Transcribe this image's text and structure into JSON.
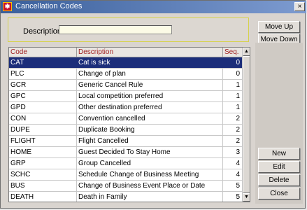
{
  "window": {
    "title": "Cancellation Codes",
    "close_glyph": "×"
  },
  "search": {
    "description_label": "Description",
    "description_value": ""
  },
  "table": {
    "headers": {
      "code": "Code",
      "description": "Description",
      "seq": "Seq."
    },
    "rows": [
      {
        "code": "CAT",
        "description": "Cat is sick",
        "seq": "0",
        "selected": true
      },
      {
        "code": "PLC",
        "description": "Change of plan",
        "seq": "0"
      },
      {
        "code": "GCR",
        "description": "Generic Cancel Rule",
        "seq": "1"
      },
      {
        "code": "GPC",
        "description": "Local competition preferred",
        "seq": "1"
      },
      {
        "code": "GPD",
        "description": "Other destination preferred",
        "seq": "1"
      },
      {
        "code": "CON",
        "description": "Convention cancelled",
        "seq": "2"
      },
      {
        "code": "DUPE",
        "description": "Duplicate Booking",
        "seq": "2"
      },
      {
        "code": "FLIGHT",
        "description": "Flight Cancelled",
        "seq": "2"
      },
      {
        "code": "HOME",
        "description": "Guest Decided To Stay Home",
        "seq": "3"
      },
      {
        "code": "GRP",
        "description": "Group Cancelled",
        "seq": "4"
      },
      {
        "code": "SCHC",
        "description": "Schedule Change of Business Meeting",
        "seq": "4"
      },
      {
        "code": "BUS",
        "description": "Change of Business Event Place or Date",
        "seq": "5"
      },
      {
        "code": "DEATH",
        "description": "Death in Family",
        "seq": "5"
      }
    ]
  },
  "buttons": {
    "move_up": "Move Up",
    "move_down": "Move Down",
    "new": "New",
    "edit": "Edit",
    "delete": "Delete",
    "close": "Close"
  },
  "colors": {
    "title_bar": "#3a5f9b",
    "selected_row": "#1c2e7a",
    "header_text": "#a02020",
    "input_bg": "#fcfbe6"
  },
  "icons": {
    "app": "app-logo-icon",
    "scroll_up": "scroll-up-arrow-icon",
    "scroll_down": "scroll-down-arrow-icon"
  }
}
